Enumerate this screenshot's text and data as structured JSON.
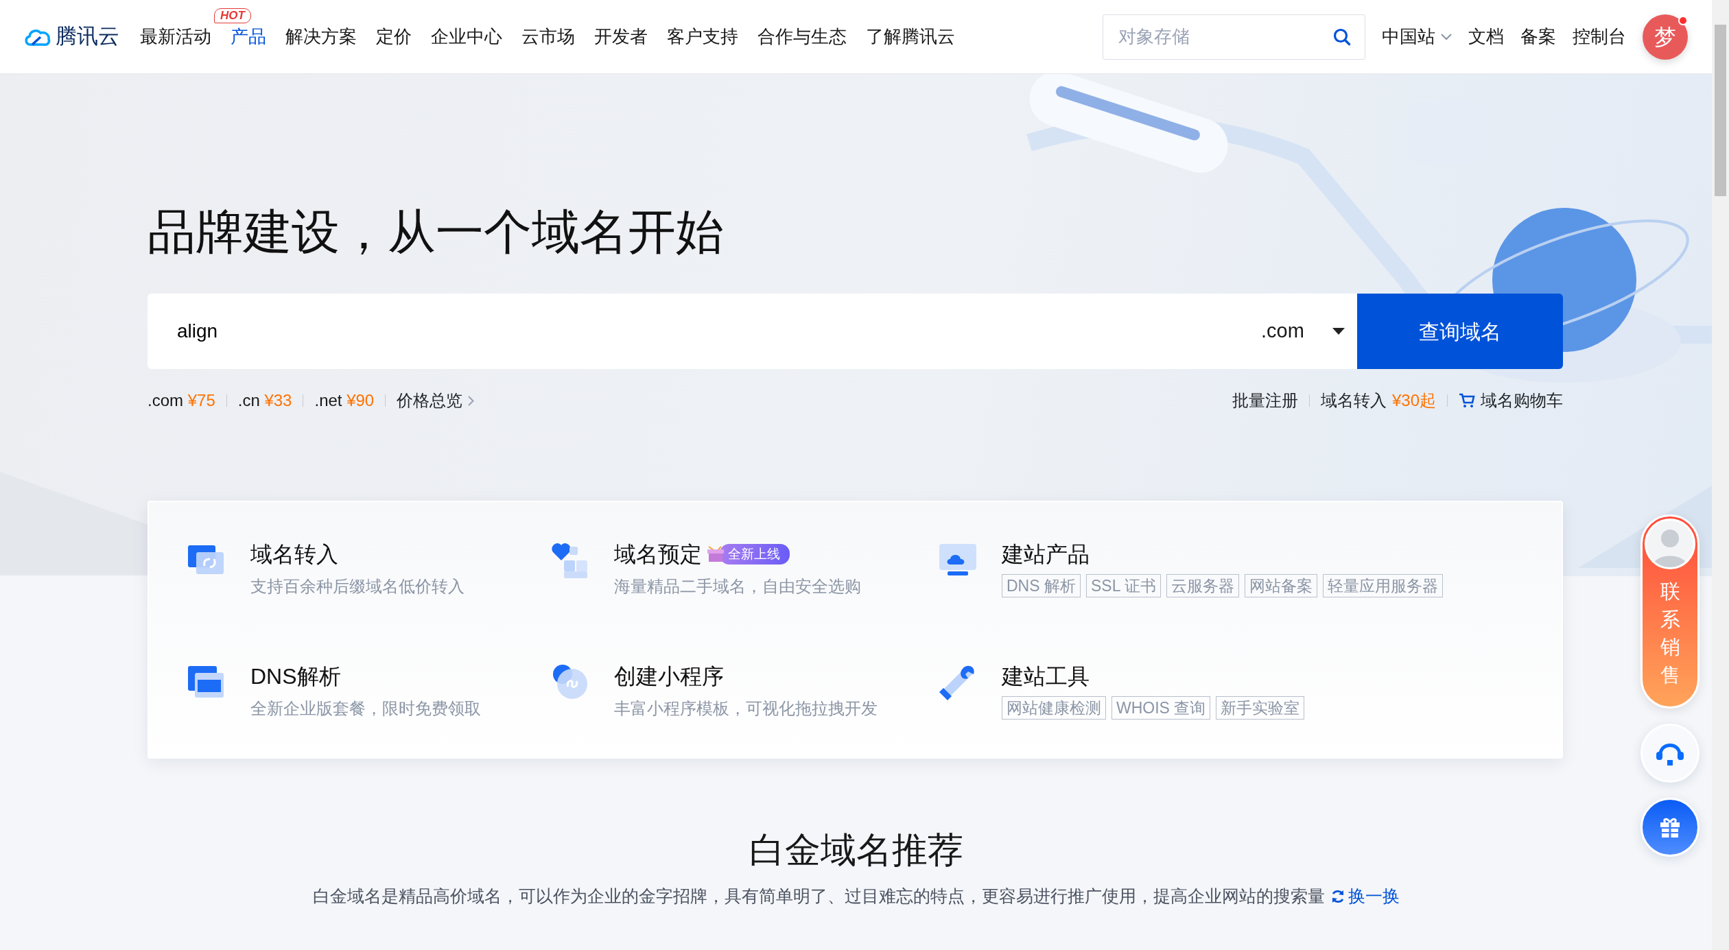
{
  "nav": {
    "logo": "腾讯云",
    "items": [
      {
        "label": "最新活动",
        "selected": false
      },
      {
        "label": "产品",
        "selected": true,
        "badge": "HOT"
      },
      {
        "label": "解决方案",
        "selected": false
      },
      {
        "label": "定价",
        "selected": false
      },
      {
        "label": "企业中心",
        "selected": false
      },
      {
        "label": "云市场",
        "selected": false
      },
      {
        "label": "开发者",
        "selected": false
      },
      {
        "label": "客户支持",
        "selected": false
      },
      {
        "label": "合作与生态",
        "selected": false
      },
      {
        "label": "了解腾讯云",
        "selected": false
      }
    ],
    "search": {
      "placeholder": "对象存储"
    },
    "links": [
      {
        "label": "中国站",
        "dropdown": true
      },
      {
        "label": "文档",
        "dropdown": false
      },
      {
        "label": "备案",
        "dropdown": false
      },
      {
        "label": "控制台",
        "dropdown": false
      }
    ],
    "user": {
      "initial": "梦",
      "notification": true
    }
  },
  "hero": {
    "title": "品牌建设，从一个域名开始",
    "query": {
      "value": "align"
    },
    "suffix": ".com",
    "button": "查询域名",
    "prices": [
      {
        "tld": ".com",
        "price": "¥75"
      },
      {
        "tld": ".cn",
        "price": "¥33"
      },
      {
        "tld": ".net",
        "price": "¥90"
      }
    ],
    "price_link": "价格总览",
    "links": [
      {
        "label": "批量注册",
        "kind": "plain"
      },
      {
        "label": "域名转入",
        "price": "¥30起",
        "kind": "plain"
      },
      {
        "label": "域名购物车",
        "kind": "cart"
      }
    ]
  },
  "features": [
    {
      "title": "域名转入",
      "desc": "支持百余种后缀域名低价转入"
    },
    {
      "title": "域名预定",
      "badge": "全新上线",
      "desc": "海量精品二手域名，自由安全选购"
    },
    {
      "title": "建站产品",
      "tags": [
        "DNS 解析",
        "SSL 证书",
        "云服务器",
        "网站备案",
        "轻量应用服务器"
      ]
    },
    {
      "title": "DNS解析",
      "desc": "全新企业版套餐，限时免费领取"
    },
    {
      "title": "创建小程序",
      "desc": "丰富小程序模板，可视化拖拉拽开发"
    },
    {
      "title": "建站工具",
      "tags": [
        "网站健康检测",
        "WHOIS 查询",
        "新手实验室"
      ]
    }
  ],
  "section": {
    "title": "白金域名推荐",
    "desc": "白金域名是精品高价域名，可以作为企业的金字招牌，具有简单明了、过目难忘的特点，更容易进行推广使用，提高企业网站的搜索量",
    "link": "换一换"
  },
  "float": {
    "contact": "联系销售"
  }
}
